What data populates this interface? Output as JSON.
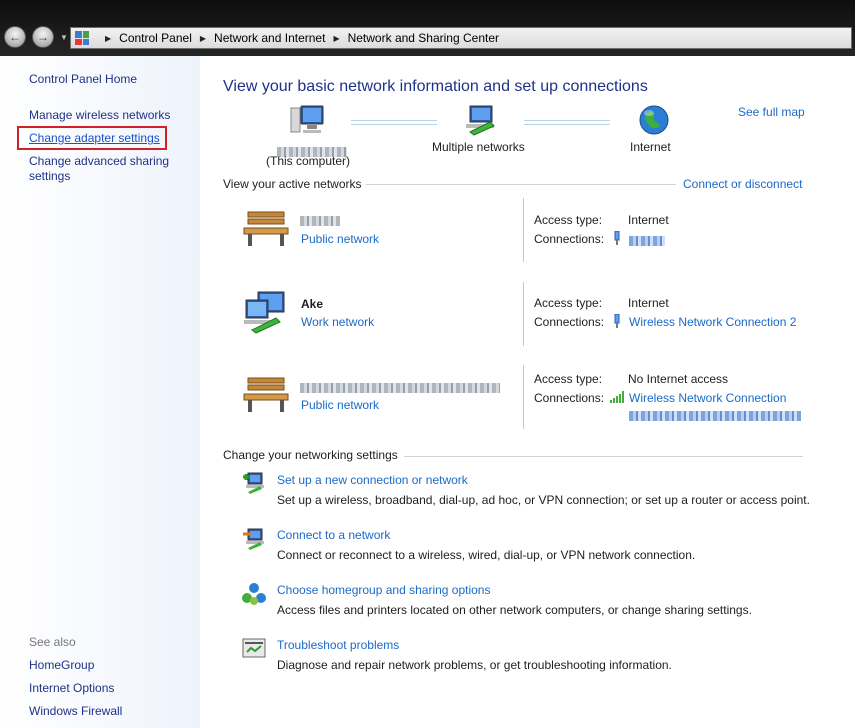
{
  "address_bar": {
    "crumbs": [
      "Control Panel",
      "Network and Internet",
      "Network and Sharing Center"
    ]
  },
  "sidebar": {
    "home": "Control Panel Home",
    "tasks": [
      "Manage wireless networks",
      "Change adapter settings",
      "Change advanced sharing settings"
    ],
    "see_also_title": "See also",
    "see_also": [
      "HomeGroup",
      "Internet Options",
      "Windows Firewall"
    ]
  },
  "main": {
    "title": "View your basic network information and set up connections",
    "see_full_map": "See full map",
    "map": {
      "computer_caption": "(This computer)",
      "middle_label": "Multiple networks",
      "internet_label": "Internet"
    },
    "active_networks_title": "View your active networks",
    "connect_or_disconnect": "Connect or disconnect",
    "networks": [
      {
        "name": "",
        "category": "Public network",
        "access_label": "Access type:",
        "access_value": "Internet",
        "connections_label": "Connections:",
        "connection": ""
      },
      {
        "name": "Ake",
        "category": "Work network",
        "access_label": "Access type:",
        "access_value": "Internet",
        "connections_label": "Connections:",
        "connection": "Wireless Network Connection 2"
      },
      {
        "name": "",
        "category": "Public network",
        "access_label": "Access type:",
        "access_value": "No Internet access",
        "connections_label": "Connections:",
        "connection": "Wireless Network Connection"
      }
    ],
    "settings_title": "Change your networking settings",
    "settings": [
      {
        "title": "Set up a new connection or network",
        "desc": "Set up a wireless, broadband, dial-up, ad hoc, or VPN connection; or set up a router or access point."
      },
      {
        "title": "Connect to a network",
        "desc": "Connect or reconnect to a wireless, wired, dial-up, or VPN network connection."
      },
      {
        "title": "Choose homegroup and sharing options",
        "desc": "Access files and printers located on other network computers, or change sharing settings."
      },
      {
        "title": "Troubleshoot problems",
        "desc": "Diagnose and repair network problems, or get troubleshooting information."
      }
    ]
  }
}
